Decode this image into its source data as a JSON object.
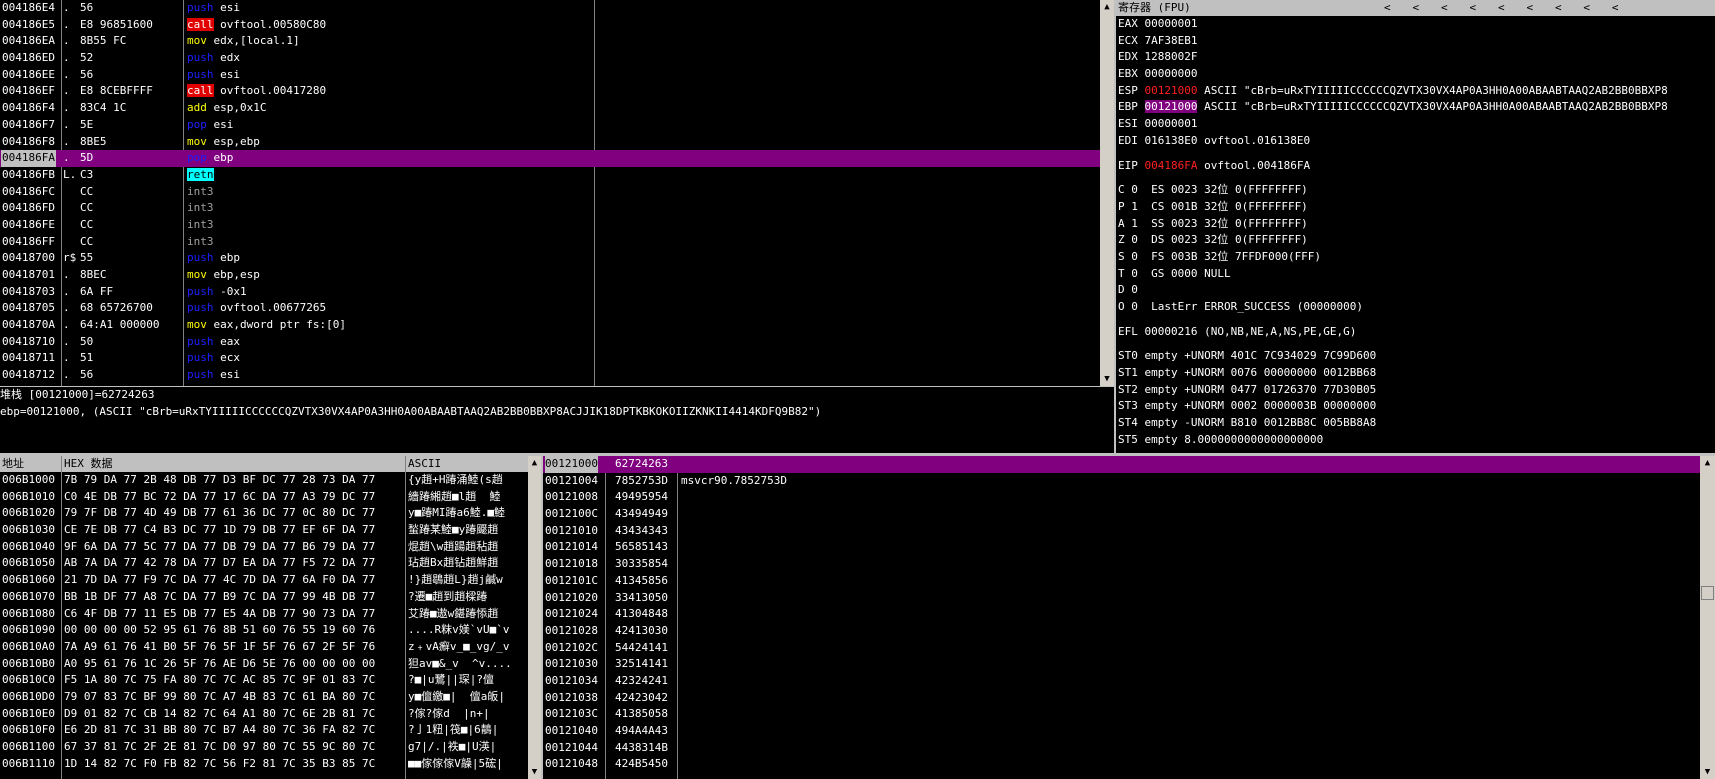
{
  "disasm": {
    "rows": [
      {
        "addr": "004186E4",
        "tick": ".",
        "hex": "56",
        "mn": "push",
        "mc": "m-push",
        "ops": "esi"
      },
      {
        "addr": "004186E5",
        "tick": ".",
        "hex": "E8 96851600",
        "mn": "call",
        "mc": "m-call",
        "ops": "ovftool.00580C80"
      },
      {
        "addr": "004186EA",
        "tick": ".",
        "hex": "8B55 FC",
        "mn": "mov",
        "mc": "m-mov",
        "ops": "edx,[local.1]"
      },
      {
        "addr": "004186ED",
        "tick": ".",
        "hex": "52",
        "mn": "push",
        "mc": "m-push",
        "ops": "edx"
      },
      {
        "addr": "004186EE",
        "tick": ".",
        "hex": "56",
        "mn": "push",
        "mc": "m-push",
        "ops": "esi"
      },
      {
        "addr": "004186EF",
        "tick": ".",
        "hex": "E8 8CEBFFFF",
        "mn": "call",
        "mc": "m-call",
        "ops": "ovftool.00417280"
      },
      {
        "addr": "004186F4",
        "tick": ".",
        "hex": "83C4 1C",
        "mn": "add",
        "mc": "m-add",
        "ops": "esp,0x1C"
      },
      {
        "addr": "004186F7",
        "tick": ".",
        "hex": "5E",
        "mn": "pop",
        "mc": "m-push",
        "ops": "esi"
      },
      {
        "addr": "004186F8",
        "tick": ".",
        "hex": "8BE5",
        "mn": "mov",
        "mc": "m-mov",
        "ops": "esp,ebp"
      },
      {
        "addr": "004186FA",
        "tick": ".",
        "hex": "5D",
        "mn": "pop",
        "mc": "m-push",
        "ops": "ebp",
        "sel": true
      },
      {
        "addr": "004186FB",
        "tick": "L.",
        "hex": "C3",
        "mn": "retn",
        "mc": "m-retn",
        "ops": ""
      },
      {
        "addr": "004186FC",
        "tick": "",
        "hex": "CC",
        "mn": "int3",
        "mc": "m-int",
        "ops": ""
      },
      {
        "addr": "004186FD",
        "tick": "",
        "hex": "CC",
        "mn": "int3",
        "mc": "m-int",
        "ops": ""
      },
      {
        "addr": "004186FE",
        "tick": "",
        "hex": "CC",
        "mn": "int3",
        "mc": "m-int",
        "ops": ""
      },
      {
        "addr": "004186FF",
        "tick": "",
        "hex": "CC",
        "mn": "int3",
        "mc": "m-int",
        "ops": ""
      },
      {
        "addr": "00418700",
        "tick": "r$",
        "hex": "55",
        "mn": "push",
        "mc": "m-push",
        "ops": "ebp"
      },
      {
        "addr": "00418701",
        "tick": ".",
        "hex": "8BEC",
        "mn": "mov",
        "mc": "m-mov",
        "ops": "ebp,esp"
      },
      {
        "addr": "00418703",
        "tick": ".",
        "hex": "6A FF",
        "mn": "push",
        "mc": "m-push",
        "ops": "-0x1"
      },
      {
        "addr": "00418705",
        "tick": ".",
        "hex": "68 65726700",
        "mn": "push",
        "mc": "m-push",
        "ops": "ovftool.00677265"
      },
      {
        "addr": "0041870A",
        "tick": ".",
        "hex": "64:A1 000000",
        "mn": "mov",
        "mc": "m-mov",
        "ops": "eax,dword ptr fs:[0]"
      },
      {
        "addr": "00418710",
        "tick": ".",
        "hex": "50",
        "mn": "push",
        "mc": "m-push",
        "ops": "eax"
      },
      {
        "addr": "00418711",
        "tick": ".",
        "hex": "51",
        "mn": "push",
        "mc": "m-push",
        "ops": "ecx"
      },
      {
        "addr": "00418712",
        "tick": ".",
        "hex": "56",
        "mn": "push",
        "mc": "m-push",
        "ops": "esi"
      }
    ]
  },
  "info": {
    "line1": "堆栈 [00121000]=62724263",
    "line2": "ebp=00121000, (ASCII \"cBrb=uRxTYIIIIICCCCCCQZVTX30VX4AP0A3HH0A00ABAABTAAQ2AB2BB0BBXP8ACJJIK18DPTKBKOKOIIZKNKII4414KDFQ9B82\")"
  },
  "registers": {
    "title": "寄存器 (FPU)",
    "arrows": "<   <   <   <   <   <   <   <   <",
    "gp": [
      {
        "name": "EAX",
        "val": "00000001",
        "extra": ""
      },
      {
        "name": "ECX",
        "val": "7AF38EB1",
        "extra": ""
      },
      {
        "name": "EDX",
        "val": "1288002F",
        "extra": ""
      },
      {
        "name": "EBX",
        "val": "00000000",
        "extra": ""
      },
      {
        "name": "ESP",
        "val": "00121000",
        "extra": "ASCII \"cBrb=uRxTYIIIIICCCCCCQZVTX30VX4AP0A3HH0A00ABAABTAAQ2AB2BB0BBXP8",
        "style": "red"
      },
      {
        "name": "EBP",
        "val": "00121000",
        "extra": "ASCII \"cBrb=uRxTYIIIIICCCCCCQZVTX30VX4AP0A3HH0A00ABAABTAAQ2AB2BB0BBXP8",
        "style": "hl"
      },
      {
        "name": "ESI",
        "val": "00000001",
        "extra": ""
      },
      {
        "name": "EDI",
        "val": "016138E0",
        "extra": "ovftool.016138E0"
      }
    ],
    "eip": {
      "name": "EIP",
      "val": "004186FA",
      "extra": "ovftool.004186FA"
    },
    "flags": [
      "C 0  ES 0023 32位 0(FFFFFFFF)",
      "P 1  CS 001B 32位 0(FFFFFFFF)",
      "A 1  SS 0023 32位 0(FFFFFFFF)",
      "Z 0  DS 0023 32位 0(FFFFFFFF)",
      "S 0  FS 003B 32位 7FFDF000(FFF)",
      "T 0  GS 0000 NULL",
      "D 0",
      "O 0  LastErr ERROR_SUCCESS (00000000)"
    ],
    "efl": "EFL 00000216 (NO,NB,NE,A,NS,PE,GE,G)",
    "fpu": [
      "ST0 empty +UNORM 401C 7C934029 7C99D600",
      "ST1 empty +UNORM 0076 00000000 0012BB68",
      "ST2 empty +UNORM 0477 01726370 77D30B05",
      "ST3 empty +UNORM 0002 0000003B 00000000",
      "ST4 empty -UNORM B810 0012BB8C 005BB8A8",
      "ST5 empty 8.0000000000000000000"
    ]
  },
  "dump": {
    "headers": {
      "addr": "地址",
      "hex": "HEX 数据",
      "ascii": "ASCII"
    },
    "rows": [
      {
        "a": "006B1000",
        "h": "7B 79 DA 77 2B 48 DB 77 D3 BF DC 77 28 73 DA 77",
        "s": "{y趙+H踳涌鯥(s趙"
      },
      {
        "a": "006B1010",
        "h": "C0 4E DB 77 BC 72 DA 77 17 6C DA 77 A3 79 DC 77",
        "s": "繬踳緗趙■l趙  鯥"
      },
      {
        "a": "006B1020",
        "h": "79 7F DB 77 4D 49 DB 77 61 36 DC 77 0C 80 DC 77",
        "s": "y■踳MI踳a6鯥.■鯥"
      },
      {
        "a": "006B1030",
        "h": "CE 7E DB 77 C4 B3 DC 77 1D 79 DB 77 EF 6F DA 77",
        "s": "蝵踳某鯥■y踳飋趙"
      },
      {
        "a": "006B1040",
        "h": "9F 6A DA 77 5C 77 DA 77 DB 79 DA 77 B6 79 DA 77",
        "s": "焜趙\\w趙踼趙秥趙"
      },
      {
        "a": "006B1050",
        "h": "AB 7A DA 77 42 78 DA 77 D7 EA DA 77 F5 72 DA 77",
        "s": "玷趙Bx趙钻趙鮮趙"
      },
      {
        "a": "006B1060",
        "h": "21 7D DA 77 F9 7C DA 77 4C 7D DA 77 6A F0 DA 77",
        "s": "!}趙鶡趙L}趙j鹹w"
      },
      {
        "a": "006B1070",
        "h": "BB 1B DF 77 A8 7C DA 77 B9 7C DA 77 99 4B DB 77",
        "s": "?遷■趙到趙樑踳"
      },
      {
        "a": "006B1080",
        "h": "C6 4F DB 77 11 E5 DB 77 E5 4A DB 77 90 73 DA 77",
        "s": "艾踳■遨w鍖踳悿趙"
      },
      {
        "a": "006B1090",
        "h": "00 00 00 00 52 95 61 76 8B 51 60 76 55 19 60 76",
        "s": "....R粖v媄`vU■`v"
      },
      {
        "a": "006B10A0",
        "h": "7A A9 61 76 41 B0 5F 76 5F 1F 5F 76 67 2F 5F 76",
        "s": "z﹢vA癬v_■_vg/_v"
      },
      {
        "a": "006B10B0",
        "h": "A0 95 61 76 1C 26 5F 76 AE D6 5E 76 00 00 00 00",
        "s": "狚av■&_v  ^v...."
      },
      {
        "a": "006B10C0",
        "h": "F5 1A 80 7C 75 FA 80 7C 7C AC 85 7C 9F 01 83 7C",
        "s": "?■|u鷺||琛|?儃"
      },
      {
        "a": "006B10D0",
        "h": "79 07 83 7C BF 99 80 7C A7 4B 83 7C 61 BA 80 7C",
        "s": "y■儃繳■|  儃a皈|"
      },
      {
        "a": "006B10E0",
        "h": "D9 01 82 7C CB 14 82 7C 64 A1 80 7C 6E 2B 81 7C",
        "s": "?傢?傢d  |n+|"
      },
      {
        "a": "006B10F0",
        "h": "E6 2D 81 7C 31 BB 80 7C B7 A4 80 7C 36 FA 82 7C",
        "s": "?亅1粈|筏■|6鶄|"
      },
      {
        "a": "006B1100",
        "h": "67 37 81 7C 2F 2E 81 7C D0 97 80 7C 55 9C 80 7C",
        "s": "g7|/.|袟■|U渶|"
      },
      {
        "a": "006B1110",
        "h": "1D 14 82 7C F0 FB 82 7C 56 F2 81 7C 35 B3 85 7C",
        "s": "■■傢傢傢V髞|5硡|"
      }
    ]
  },
  "stack": {
    "rows": [
      {
        "a": "00121000",
        "v": "62724263",
        "c": "",
        "first": true
      },
      {
        "a": "00121004",
        "v": "7852753D",
        "c": "msvcr90.7852753D"
      },
      {
        "a": "00121008",
        "v": "49495954",
        "c": ""
      },
      {
        "a": "0012100C",
        "v": "43494949",
        "c": ""
      },
      {
        "a": "00121010",
        "v": "43434343",
        "c": ""
      },
      {
        "a": "00121014",
        "v": "56585143",
        "c": ""
      },
      {
        "a": "00121018",
        "v": "30335854",
        "c": ""
      },
      {
        "a": "0012101C",
        "v": "41345856",
        "c": ""
      },
      {
        "a": "00121020",
        "v": "33413050",
        "c": ""
      },
      {
        "a": "00121024",
        "v": "41304848",
        "c": ""
      },
      {
        "a": "00121028",
        "v": "42413030",
        "c": ""
      },
      {
        "a": "0012102C",
        "v": "54424141",
        "c": ""
      },
      {
        "a": "00121030",
        "v": "32514141",
        "c": ""
      },
      {
        "a": "00121034",
        "v": "42324241",
        "c": ""
      },
      {
        "a": "00121038",
        "v": "42423042",
        "c": ""
      },
      {
        "a": "0012103C",
        "v": "41385058",
        "c": ""
      },
      {
        "a": "00121040",
        "v": "494A4A43",
        "c": ""
      },
      {
        "a": "00121044",
        "v": "4438314B",
        "c": ""
      },
      {
        "a": "00121048",
        "v": "424B5450",
        "c": ""
      }
    ]
  },
  "colors": {
    "selection": "#800080",
    "push": "#2020ff",
    "call_bg": "#e00000",
    "mov": "#ffff00",
    "retn_bg": "#00ffff",
    "reg_changed": "#ff2020"
  },
  "icons": {
    "scroll_up": "triangle-up",
    "scroll_down": "triangle-down",
    "reg_nav": "chevron-left"
  }
}
